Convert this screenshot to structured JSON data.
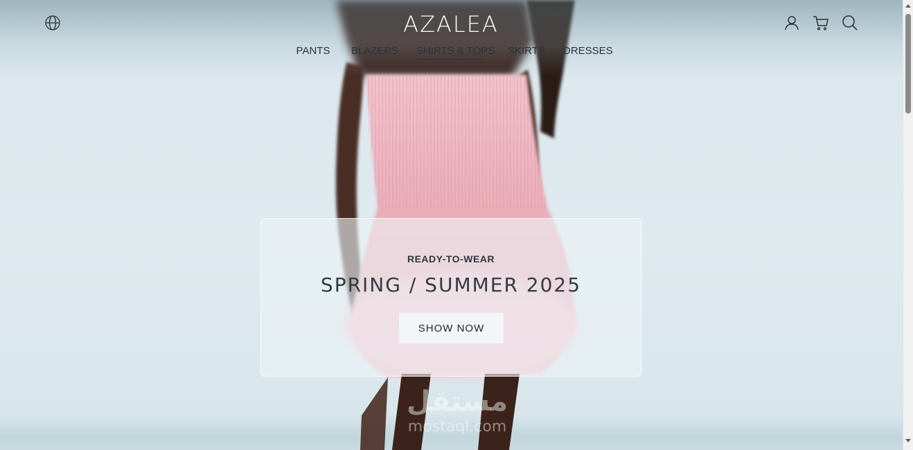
{
  "brand": "AZALEA",
  "nav": [
    {
      "label": "PANTS",
      "active": false
    },
    {
      "label": "BLAZERS",
      "active": false
    },
    {
      "label": "SHIRTS & TOPS",
      "active": true
    },
    {
      "label": "SKIRTS",
      "active": false
    },
    {
      "label": "DRESSES",
      "active": false
    }
  ],
  "header_icons": {
    "left": "globe-icon",
    "right": [
      "user-icon",
      "cart-icon",
      "search-icon"
    ]
  },
  "hero": {
    "eyebrow": "READY-TO-WEAR",
    "headline": "SPRING / SUMMER 2025",
    "cta": "SHOW NOW"
  },
  "watermark": {
    "arabic": "مستقل",
    "latin": "mostaql.com"
  },
  "colors": {
    "text_dark": "#2c3238",
    "background": "#dfe9ee",
    "dress_pink": "#eeb6c0",
    "skin": "#3a2520"
  }
}
